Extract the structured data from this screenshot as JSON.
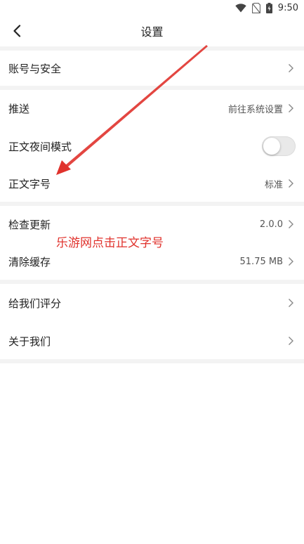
{
  "status_bar": {
    "time": "9:50",
    "icons": [
      "wifi-icon",
      "no-sim-icon",
      "battery-icon"
    ]
  },
  "header": {
    "title": "设置",
    "back_icon": "chevron-left-icon"
  },
  "rows": {
    "account": {
      "label": "账号与安全"
    },
    "push": {
      "label": "推送",
      "value": "前往系统设置"
    },
    "night_mode": {
      "label": "正文夜间模式",
      "enabled": false
    },
    "font_size": {
      "label": "正文字号",
      "value": "标准"
    },
    "check_update": {
      "label": "检查更新",
      "value": "2.0.0"
    },
    "clear_cache": {
      "label": "清除缓存",
      "value": "51.75 MB"
    },
    "rate_us": {
      "label": "给我们评分"
    },
    "about": {
      "label": "关于我们"
    }
  },
  "annotation": {
    "text": "乐游网点击正文字号",
    "color": "#e0322c"
  }
}
